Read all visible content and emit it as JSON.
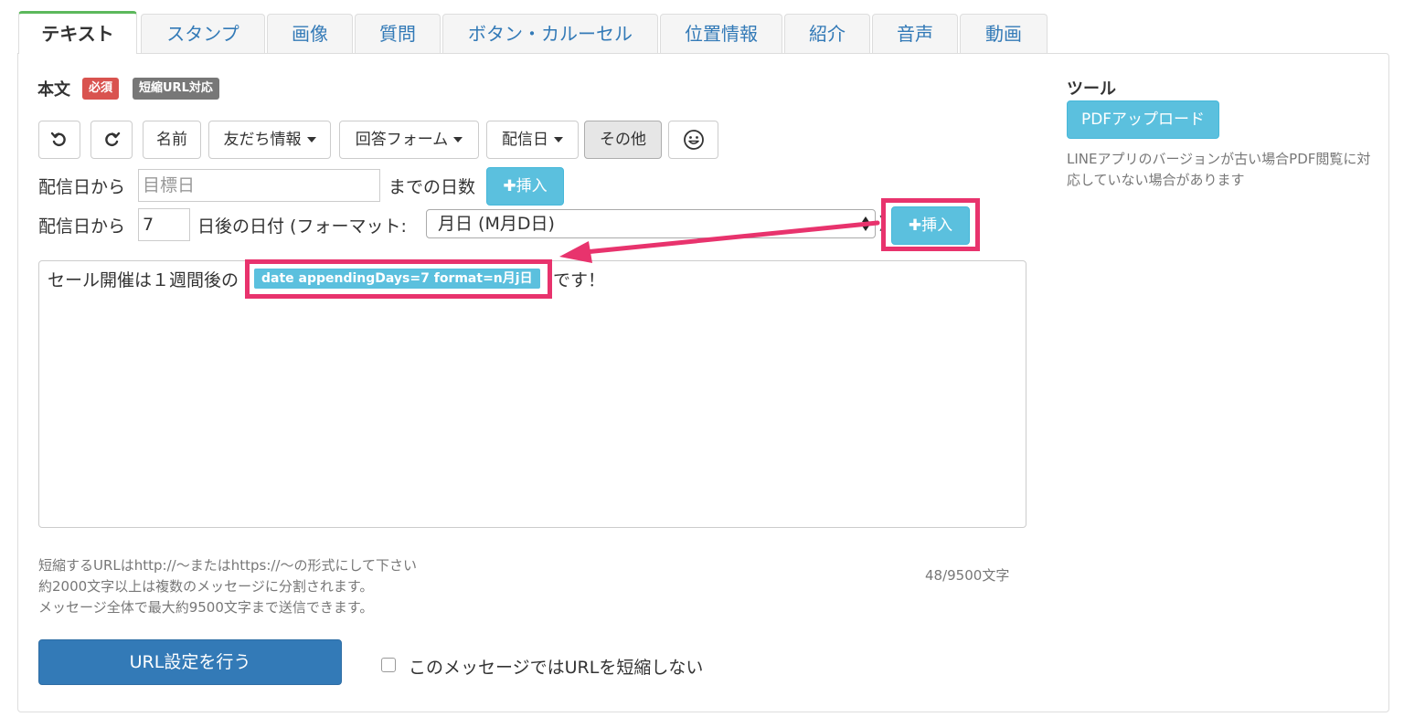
{
  "tabs": [
    {
      "label": "テキスト",
      "active": true
    },
    {
      "label": "スタンプ"
    },
    {
      "label": "画像"
    },
    {
      "label": "質問"
    },
    {
      "label": "ボタン・カルーセル"
    },
    {
      "label": "位置情報"
    },
    {
      "label": "紹介"
    },
    {
      "label": "音声"
    },
    {
      "label": "動画"
    }
  ],
  "body_section": {
    "label": "本文",
    "required_badge": "必須",
    "short_url_badge": "短縮URL対応"
  },
  "toolbar": {
    "undo_icon": "undo-icon",
    "redo_icon": "redo-icon",
    "name": "名前",
    "friend_info": "友だち情報",
    "answer_form": "回答フォーム",
    "delivery_date": "配信日",
    "other": "その他",
    "emoji_icon": "emoji-icon"
  },
  "days_until_row": {
    "prefix": "配信日から",
    "input_placeholder": "目標日",
    "suffix": "までの日数",
    "insert": "挿入"
  },
  "date_after_row": {
    "prefix": "配信日から",
    "days_value": "7",
    "suffix": "日後の日付 (フォーマット:",
    "format_selected": "月日 (M月D日)",
    "close_paren": ")",
    "insert": "挿入"
  },
  "editor": {
    "text_before": "セール開催は１週間後の",
    "tag": "date appendingDays=7 format=n月j日",
    "text_after": "です！"
  },
  "help": {
    "line1": "短縮するURLはhttp://〜またはhttps://〜の形式にして下さい",
    "line2": "約2000文字以上は複数のメッセージに分割されます。",
    "line3": "メッセージ全体で最大約9500文字まで送信できます。",
    "char_count": "48/9500文字"
  },
  "url_settings_button": "URL設定を行う",
  "no_shorten_checkbox": {
    "label": "このメッセージではURLを短縮しない",
    "checked": false
  },
  "tools": {
    "title": "ツール",
    "pdf_upload": "PDFアップロード",
    "note": "LINEアプリのバージョンが古い場合PDF閲覧に対応していない場合があります"
  },
  "colors": {
    "highlight": "#e8336d",
    "info": "#5bc0de",
    "primary": "#337ab7",
    "required": "#d9534f",
    "tab_active": "#5cb85c"
  }
}
